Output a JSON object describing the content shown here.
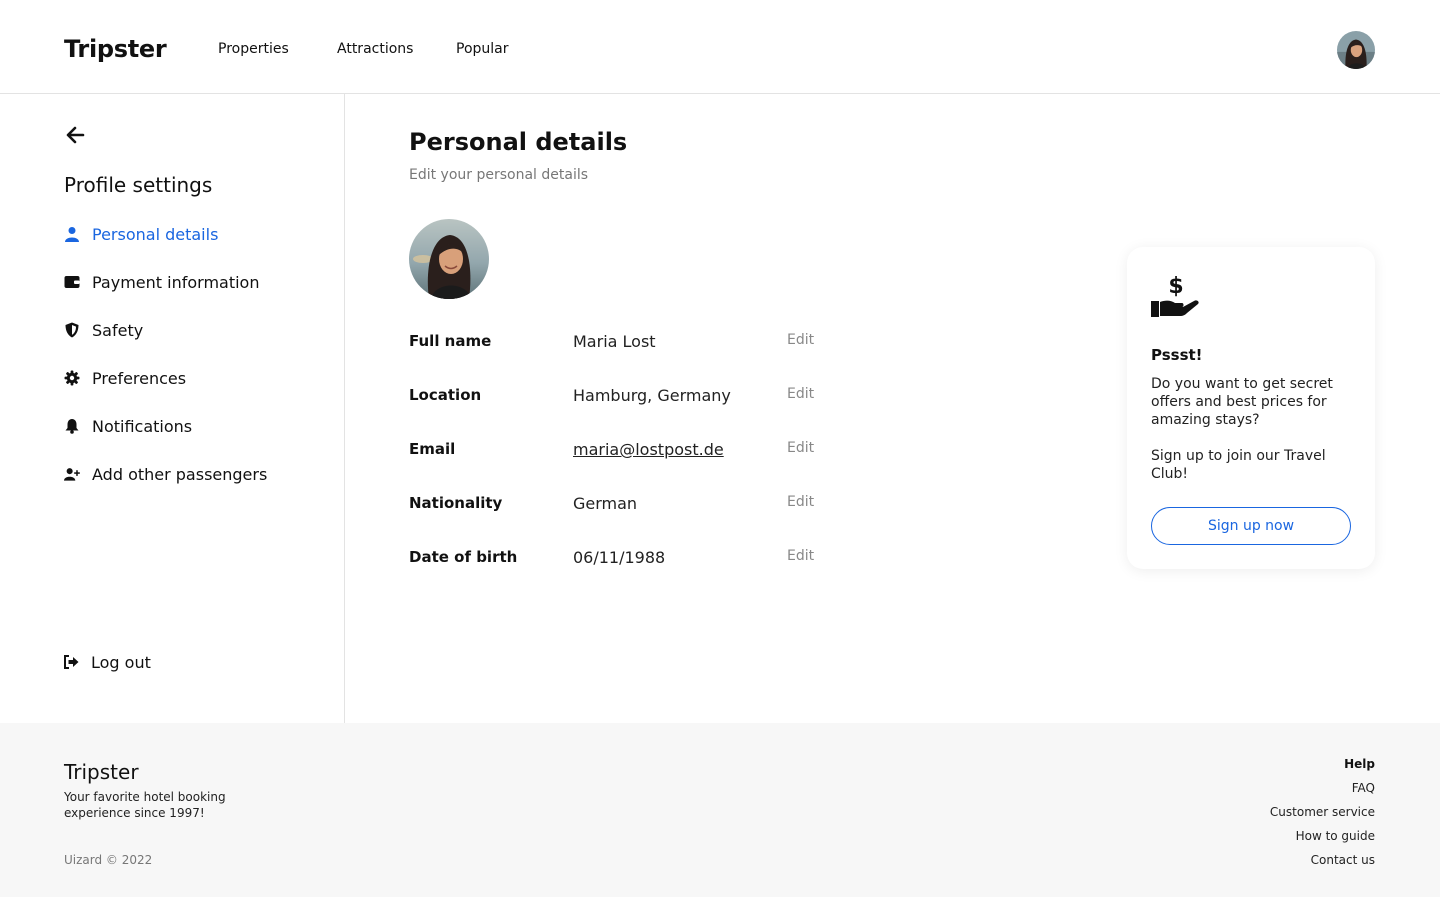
{
  "header": {
    "logo": "Tripster",
    "nav": [
      "Properties",
      "Attractions",
      "Popular"
    ]
  },
  "sidebar": {
    "title": "Profile settings",
    "items": [
      {
        "label": "Personal details",
        "icon": "user-icon",
        "active": true
      },
      {
        "label": "Payment information",
        "icon": "wallet-icon",
        "active": false
      },
      {
        "label": "Safety",
        "icon": "shield-icon",
        "active": false
      },
      {
        "label": "Preferences",
        "icon": "gear-icon",
        "active": false
      },
      {
        "label": "Notifications",
        "icon": "bell-icon",
        "active": false
      },
      {
        "label": "Add other passengers",
        "icon": "user-plus-icon",
        "active": false
      }
    ],
    "logout": "Log out"
  },
  "main": {
    "title": "Personal details",
    "subtitle": "Edit your personal details",
    "edit_label": "Edit",
    "fields": [
      {
        "label": "Full name",
        "value": "Maria Lost"
      },
      {
        "label": "Location",
        "value": "Hamburg, Germany"
      },
      {
        "label": "Email",
        "value": "maria@lostpost.de"
      },
      {
        "label": "Nationality",
        "value": "German"
      },
      {
        "label": "Date of birth",
        "value": "06/11/1988"
      }
    ]
  },
  "promo": {
    "icon": "hand-dollar-icon",
    "title": "Pssst!",
    "text1": "Do you want to get secret offers and best prices for amazing stays?",
    "text2": "Sign up to join our Travel Club!",
    "button": "Sign up now"
  },
  "footer": {
    "logo": "Tripster",
    "tagline": "Your favorite hotel booking experience since 1997!",
    "copyright": "Uizard © 2022",
    "help_title": "Help",
    "links": [
      "FAQ",
      "Customer service",
      "How to guide",
      "Contact us"
    ]
  },
  "colors": {
    "accent": "#1a66e0",
    "muted": "#777777",
    "footer_bg": "#f7f7f7",
    "divider": "#e3e3e3"
  }
}
